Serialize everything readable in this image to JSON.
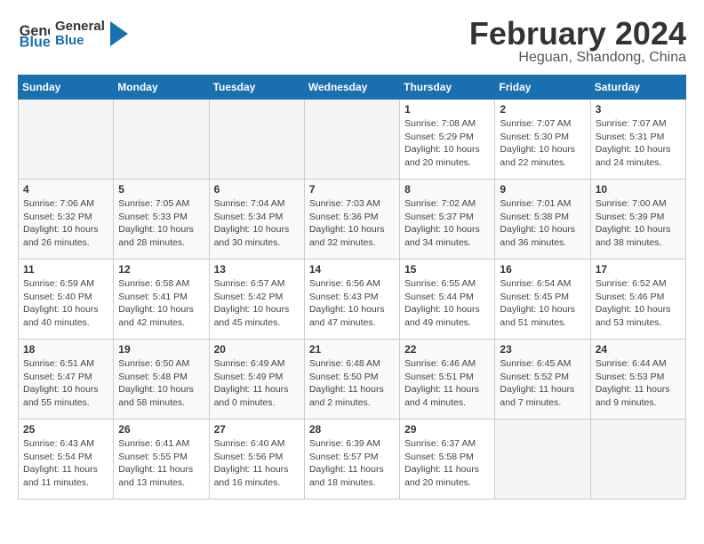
{
  "logo": {
    "line1": "General",
    "line2": "Blue"
  },
  "title": "February 2024",
  "location": "Heguan, Shandong, China",
  "weekdays": [
    "Sunday",
    "Monday",
    "Tuesday",
    "Wednesday",
    "Thursday",
    "Friday",
    "Saturday"
  ],
  "weeks": [
    [
      {
        "day": "",
        "info": ""
      },
      {
        "day": "",
        "info": ""
      },
      {
        "day": "",
        "info": ""
      },
      {
        "day": "",
        "info": ""
      },
      {
        "day": "1",
        "info": "Sunrise: 7:08 AM\nSunset: 5:29 PM\nDaylight: 10 hours\nand 20 minutes."
      },
      {
        "day": "2",
        "info": "Sunrise: 7:07 AM\nSunset: 5:30 PM\nDaylight: 10 hours\nand 22 minutes."
      },
      {
        "day": "3",
        "info": "Sunrise: 7:07 AM\nSunset: 5:31 PM\nDaylight: 10 hours\nand 24 minutes."
      }
    ],
    [
      {
        "day": "4",
        "info": "Sunrise: 7:06 AM\nSunset: 5:32 PM\nDaylight: 10 hours\nand 26 minutes."
      },
      {
        "day": "5",
        "info": "Sunrise: 7:05 AM\nSunset: 5:33 PM\nDaylight: 10 hours\nand 28 minutes."
      },
      {
        "day": "6",
        "info": "Sunrise: 7:04 AM\nSunset: 5:34 PM\nDaylight: 10 hours\nand 30 minutes."
      },
      {
        "day": "7",
        "info": "Sunrise: 7:03 AM\nSunset: 5:36 PM\nDaylight: 10 hours\nand 32 minutes."
      },
      {
        "day": "8",
        "info": "Sunrise: 7:02 AM\nSunset: 5:37 PM\nDaylight: 10 hours\nand 34 minutes."
      },
      {
        "day": "9",
        "info": "Sunrise: 7:01 AM\nSunset: 5:38 PM\nDaylight: 10 hours\nand 36 minutes."
      },
      {
        "day": "10",
        "info": "Sunrise: 7:00 AM\nSunset: 5:39 PM\nDaylight: 10 hours\nand 38 minutes."
      }
    ],
    [
      {
        "day": "11",
        "info": "Sunrise: 6:59 AM\nSunset: 5:40 PM\nDaylight: 10 hours\nand 40 minutes."
      },
      {
        "day": "12",
        "info": "Sunrise: 6:58 AM\nSunset: 5:41 PM\nDaylight: 10 hours\nand 42 minutes."
      },
      {
        "day": "13",
        "info": "Sunrise: 6:57 AM\nSunset: 5:42 PM\nDaylight: 10 hours\nand 45 minutes."
      },
      {
        "day": "14",
        "info": "Sunrise: 6:56 AM\nSunset: 5:43 PM\nDaylight: 10 hours\nand 47 minutes."
      },
      {
        "day": "15",
        "info": "Sunrise: 6:55 AM\nSunset: 5:44 PM\nDaylight: 10 hours\nand 49 minutes."
      },
      {
        "day": "16",
        "info": "Sunrise: 6:54 AM\nSunset: 5:45 PM\nDaylight: 10 hours\nand 51 minutes."
      },
      {
        "day": "17",
        "info": "Sunrise: 6:52 AM\nSunset: 5:46 PM\nDaylight: 10 hours\nand 53 minutes."
      }
    ],
    [
      {
        "day": "18",
        "info": "Sunrise: 6:51 AM\nSunset: 5:47 PM\nDaylight: 10 hours\nand 55 minutes."
      },
      {
        "day": "19",
        "info": "Sunrise: 6:50 AM\nSunset: 5:48 PM\nDaylight: 10 hours\nand 58 minutes."
      },
      {
        "day": "20",
        "info": "Sunrise: 6:49 AM\nSunset: 5:49 PM\nDaylight: 11 hours\nand 0 minutes."
      },
      {
        "day": "21",
        "info": "Sunrise: 6:48 AM\nSunset: 5:50 PM\nDaylight: 11 hours\nand 2 minutes."
      },
      {
        "day": "22",
        "info": "Sunrise: 6:46 AM\nSunset: 5:51 PM\nDaylight: 11 hours\nand 4 minutes."
      },
      {
        "day": "23",
        "info": "Sunrise: 6:45 AM\nSunset: 5:52 PM\nDaylight: 11 hours\nand 7 minutes."
      },
      {
        "day": "24",
        "info": "Sunrise: 6:44 AM\nSunset: 5:53 PM\nDaylight: 11 hours\nand 9 minutes."
      }
    ],
    [
      {
        "day": "25",
        "info": "Sunrise: 6:43 AM\nSunset: 5:54 PM\nDaylight: 11 hours\nand 11 minutes."
      },
      {
        "day": "26",
        "info": "Sunrise: 6:41 AM\nSunset: 5:55 PM\nDaylight: 11 hours\nand 13 minutes."
      },
      {
        "day": "27",
        "info": "Sunrise: 6:40 AM\nSunset: 5:56 PM\nDaylight: 11 hours\nand 16 minutes."
      },
      {
        "day": "28",
        "info": "Sunrise: 6:39 AM\nSunset: 5:57 PM\nDaylight: 11 hours\nand 18 minutes."
      },
      {
        "day": "29",
        "info": "Sunrise: 6:37 AM\nSunset: 5:58 PM\nDaylight: 11 hours\nand 20 minutes."
      },
      {
        "day": "",
        "info": ""
      },
      {
        "day": "",
        "info": ""
      }
    ]
  ]
}
